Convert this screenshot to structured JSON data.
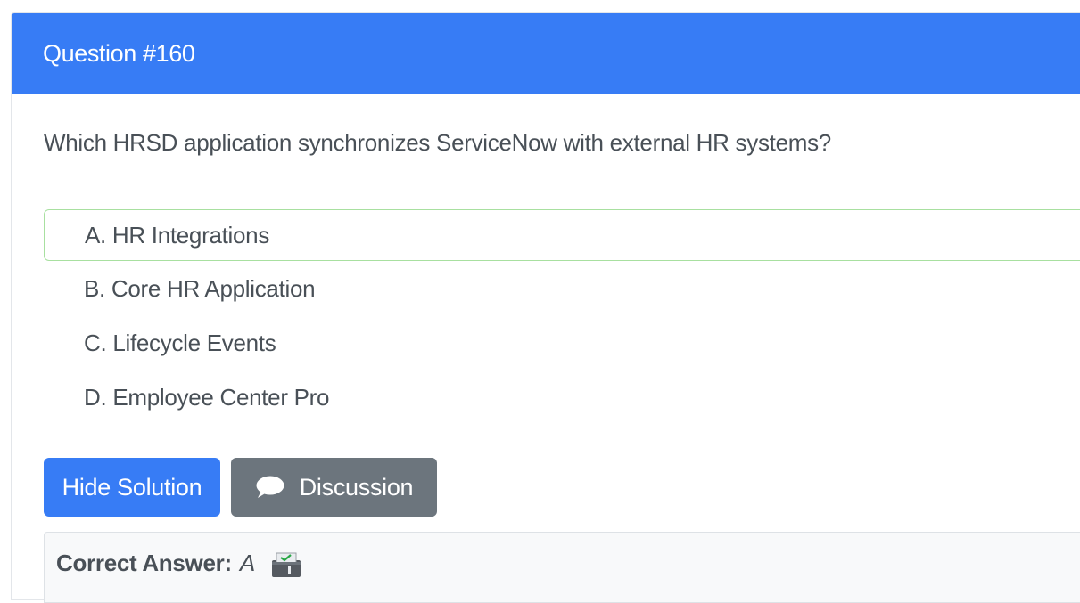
{
  "question": {
    "header": "Question #160",
    "text": "Which HRSD application synchronizes ServiceNow with external HR systems?",
    "choices": [
      {
        "label": "A. HR Integrations",
        "correct": true
      },
      {
        "label": "B. Core HR Application",
        "correct": false
      },
      {
        "label": "C. Lifecycle Events",
        "correct": false
      },
      {
        "label": "D. Employee Center Pro",
        "correct": false
      }
    ]
  },
  "buttons": {
    "hide_solution": "Hide Solution",
    "discussion": "Discussion"
  },
  "answer": {
    "label": "Correct Answer:",
    "value": "A"
  },
  "icons": {
    "discussion": "speech-bubble-icon",
    "answer": "ballot-box-icon"
  },
  "colors": {
    "primary": "#377cf5",
    "secondary": "#6c757d",
    "correct_border": "#a8e0a0"
  }
}
